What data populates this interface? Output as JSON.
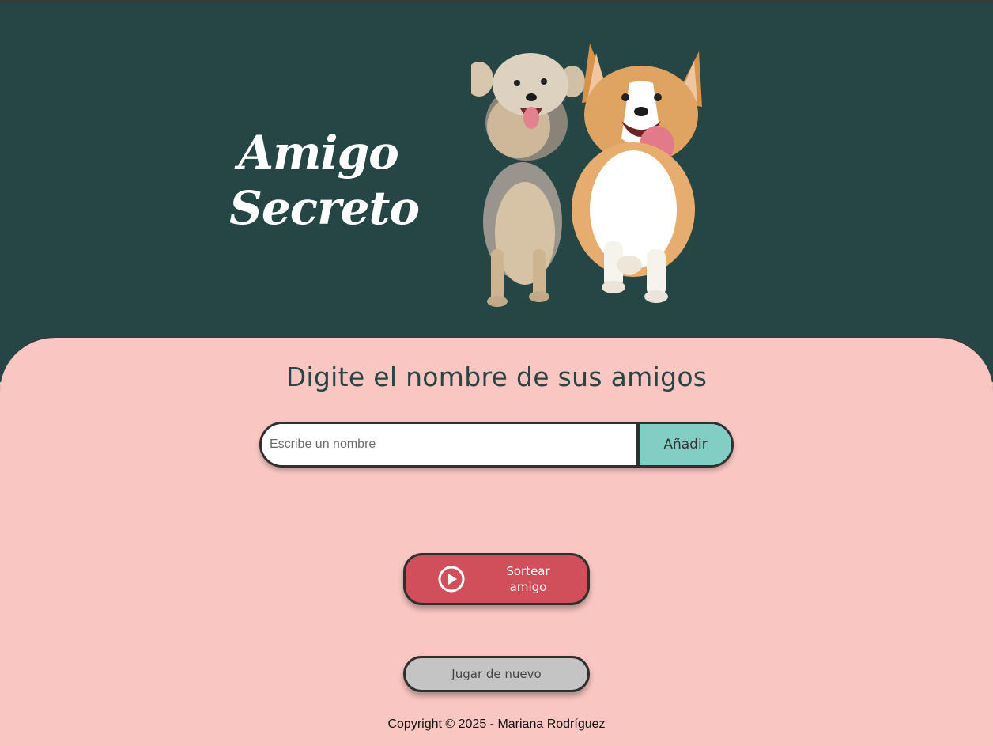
{
  "header": {
    "title_line1": "Amigo",
    "title_line2": "Secreto"
  },
  "main": {
    "heading": "Digite el nombre de sus amigos",
    "name_input_placeholder": "Escribe un nombre",
    "name_input_value": "",
    "add_button_label": "Añadir",
    "draw_button_label": "Sortear amigo",
    "reset_button_label": "Jugar de nuevo"
  },
  "footer": {
    "copyright": "Copyright © 2025 - Mariana Rodríguez"
  },
  "colors": {
    "header_bg": "#264645",
    "main_bg": "#f9c6c2",
    "add_button": "#82cdc4",
    "draw_button": "#d14e5b",
    "reset_button": "#c4c4c4"
  },
  "icons": {
    "draw_button_icon": "play-circle-icon",
    "header_image": "dogs-illustration"
  }
}
